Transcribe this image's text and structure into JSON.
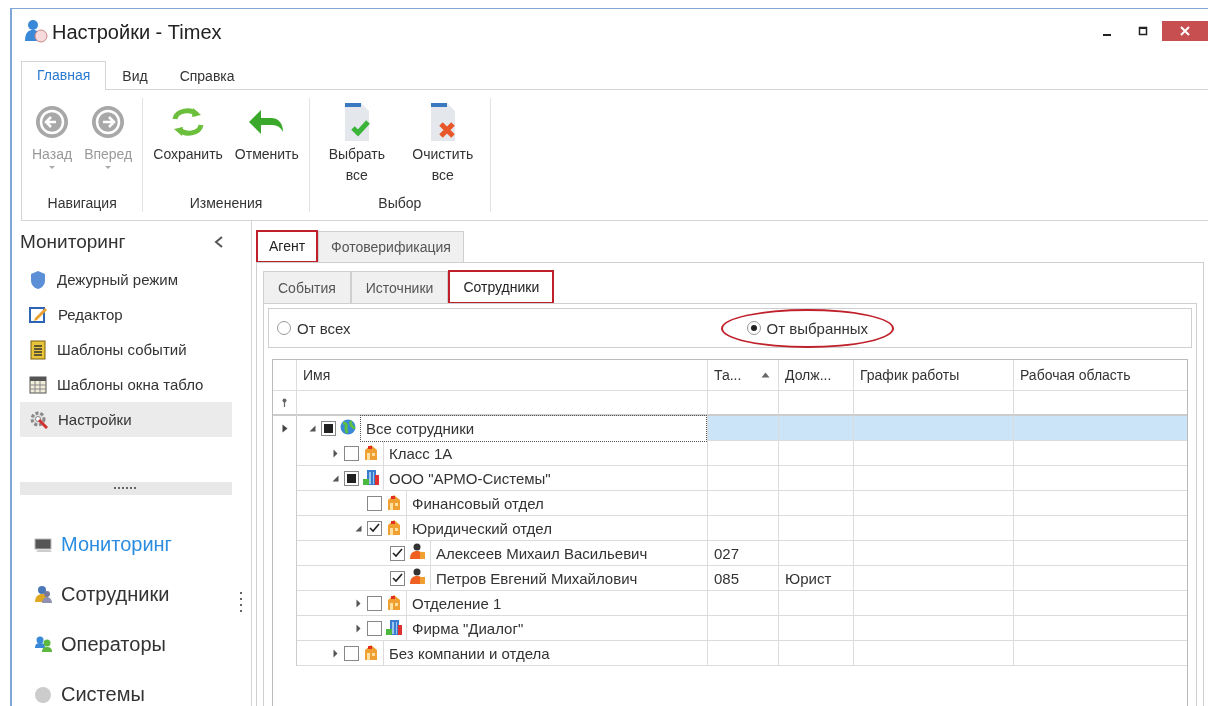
{
  "window": {
    "title": "Настройки - Timex"
  },
  "ribbon": {
    "tabs": [
      {
        "label": "Главная",
        "selected": true
      },
      {
        "label": "Вид",
        "selected": false
      },
      {
        "label": "Справка",
        "selected": false
      }
    ],
    "groups": [
      {
        "label": "Навигация",
        "buttons": [
          {
            "label": "Назад",
            "kind": "back",
            "disabled": true,
            "dropdown": true
          },
          {
            "label": "Вперед",
            "kind": "forward",
            "disabled": true,
            "dropdown": true
          }
        ]
      },
      {
        "label": "Изменения",
        "buttons": [
          {
            "label": "Сохранить",
            "kind": "refresh",
            "disabled": false,
            "dropdown": false
          },
          {
            "label": "Отменить",
            "kind": "undo",
            "disabled": false,
            "dropdown": false
          }
        ]
      },
      {
        "label": "Выбор",
        "buttons": [
          {
            "label": "Выбрать все",
            "kind": "doc-check",
            "disabled": false,
            "dropdown": false
          },
          {
            "label": "Очистить все",
            "kind": "doc-cross",
            "disabled": false,
            "dropdown": false
          }
        ]
      }
    ]
  },
  "sidebar": {
    "title": "Мониторинг",
    "items": [
      {
        "label": "Дежурный режим",
        "kind": "shield",
        "selected": false
      },
      {
        "label": "Редактор",
        "kind": "edit",
        "selected": false
      },
      {
        "label": "Шаблоны событий",
        "kind": "list",
        "selected": false
      },
      {
        "label": "Шаблоны окна табло",
        "kind": "table",
        "selected": false
      },
      {
        "label": "Настройки",
        "kind": "gear",
        "selected": true
      }
    ],
    "nav": [
      {
        "label": "Мониторинг",
        "kind": "monitor",
        "selected": true
      },
      {
        "label": "Сотрудники",
        "kind": "staff",
        "selected": false
      },
      {
        "label": "Операторы",
        "kind": "operators",
        "selected": false
      },
      {
        "label": "Системы",
        "kind": "system",
        "selected": false
      }
    ]
  },
  "content": {
    "tabs": [
      {
        "label": "Агент",
        "selected": true,
        "highlighted": true
      },
      {
        "label": "Фотоверификация",
        "selected": false,
        "highlighted": false
      }
    ],
    "subtabs": [
      {
        "label": "События",
        "selected": false,
        "highlighted": false
      },
      {
        "label": "Источники",
        "selected": false,
        "highlighted": false
      },
      {
        "label": "Сотрудники",
        "selected": true,
        "highlighted": true
      }
    ],
    "source_options": [
      {
        "label": "От всех",
        "selected": false,
        "highlighted": false
      },
      {
        "label": "От выбранных",
        "selected": true,
        "highlighted": true
      }
    ],
    "grid": {
      "columns": [
        {
          "label": "Имя",
          "sorted_ascending": false
        },
        {
          "label": "Та...",
          "sorted_ascending": true
        },
        {
          "label": "Долж...",
          "sorted_ascending": false
        },
        {
          "label": "График работы",
          "sorted_ascending": false
        },
        {
          "label": "Рабочая область",
          "sorted_ascending": false
        }
      ],
      "rows": [
        {
          "name": "Все сотрудники",
          "kind": "globe",
          "checked": false,
          "indeterminate": true,
          "expanded": true,
          "selected": true,
          "children": [
            {
              "name": "Класс 1А",
              "kind": "department",
              "checked": false,
              "indeterminate": false,
              "expanded": false,
              "selected": false
            },
            {
              "name": "ООО \"АРМО-Системы\"",
              "kind": "company",
              "checked": false,
              "indeterminate": true,
              "expanded": true,
              "selected": false,
              "children": [
                {
                  "name": "Финансовый отдел",
                  "kind": "department",
                  "checked": false,
                  "indeterminate": false,
                  "selected": false
                },
                {
                  "name": "Юридический отдел",
                  "kind": "department",
                  "checked": true,
                  "indeterminate": false,
                  "expanded": true,
                  "selected": false,
                  "children": [
                    {
                      "name": "Алексеев Михаил  Васильевич",
                      "kind": "person",
                      "checked": true,
                      "indeterminate": false,
                      "selected": false,
                      "values": [
                        "027"
                      ]
                    },
                    {
                      "name": "Петров Евгений Михайлович",
                      "kind": "person",
                      "checked": true,
                      "indeterminate": false,
                      "selected": false,
                      "values": [
                        "085",
                        "Юрист"
                      ]
                    }
                  ]
                },
                {
                  "name": "Отделение 1",
                  "kind": "department",
                  "checked": false,
                  "indeterminate": false,
                  "expanded": false,
                  "selected": false
                },
                {
                  "name": "Фирма \"Диалог\"",
                  "kind": "company",
                  "checked": false,
                  "indeterminate": false,
                  "expanded": false,
                  "selected": false
                }
              ]
            },
            {
              "name": "Без компании и отдела",
              "kind": "department",
              "checked": false,
              "indeterminate": false,
              "expanded": false,
              "selected": false
            }
          ]
        }
      ]
    }
  }
}
